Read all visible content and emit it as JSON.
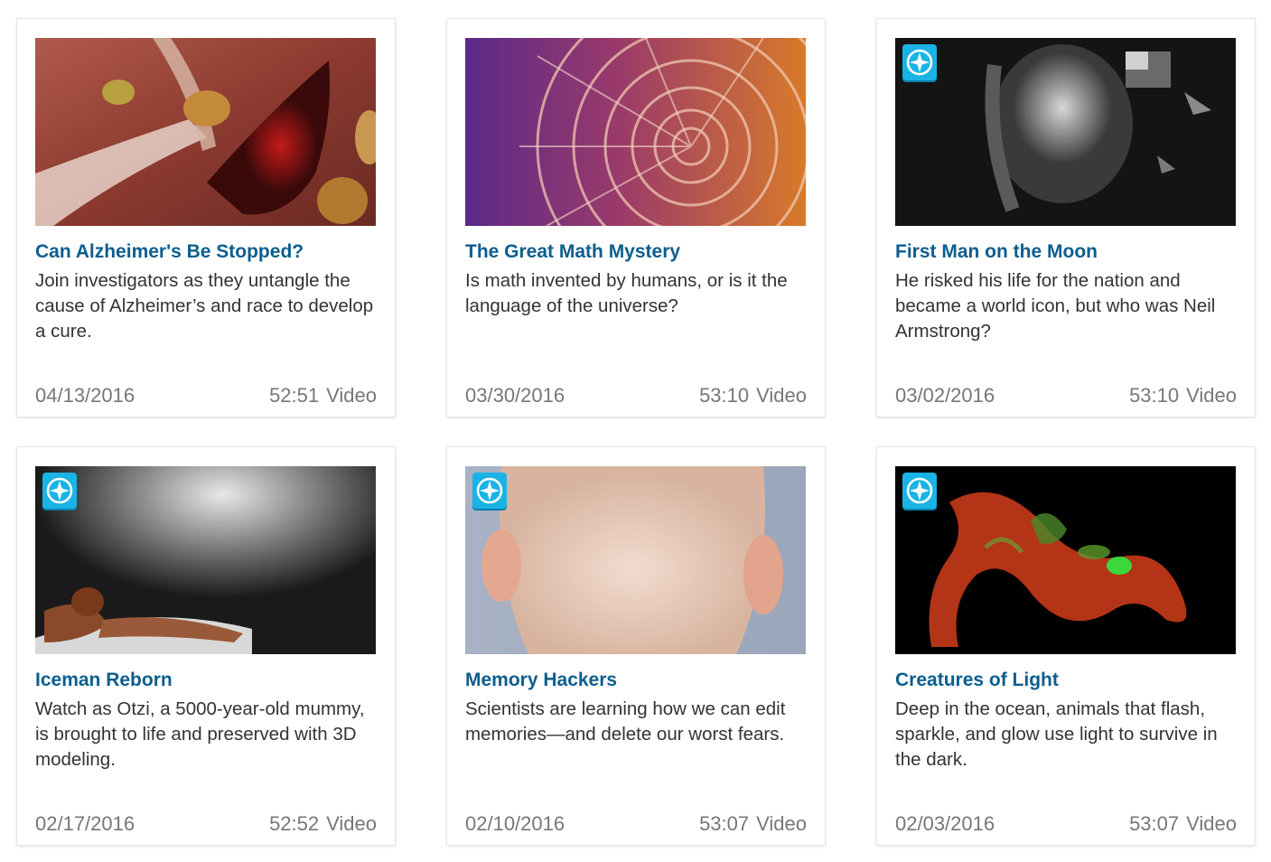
{
  "cards": [
    {
      "title": "Can Alzheimer's Be Stopped?",
      "description": "Join investigators as they untangle the cause of Alzheimer’s and race to develop a cure.",
      "date": "04/13/2016",
      "duration": "52:51",
      "type": "Video",
      "badge": false
    },
    {
      "title": "The Great Math Mystery",
      "description": "Is math invented by humans, or is it the language of the universe?",
      "date": "03/30/2016",
      "duration": "53:10",
      "type": "Video",
      "badge": false
    },
    {
      "title": "First Man on the Moon",
      "description": "He risked his life for the nation and became a world icon, but who was Neil Armstrong?",
      "date": "03/02/2016",
      "duration": "53:10",
      "type": "Video",
      "badge": true,
      "badge_icon": "compass-icon"
    },
    {
      "title": "Iceman Reborn",
      "description": "Watch as Otzi, a 5000-year-old mummy, is brought to life and preserved with 3D modeling.",
      "date": "02/17/2016",
      "duration": "52:52",
      "type": "Video",
      "badge": true,
      "badge_icon": "compass-icon"
    },
    {
      "title": "Memory Hackers",
      "description": "Scientists are learning how we can edit memories—and delete our worst fears.",
      "date": "02/10/2016",
      "duration": "53:07",
      "type": "Video",
      "badge": true,
      "badge_icon": "compass-icon"
    },
    {
      "title": "Creatures of Light",
      "description": "Deep in the ocean, animals that flash, sparkle, and glow use light to survive in the dark.",
      "date": "02/03/2016",
      "duration": "53:07",
      "type": "Video",
      "badge": true,
      "badge_icon": "compass-icon"
    }
  ],
  "colors": {
    "title": "#0b5e8e",
    "text": "#333333",
    "meta": "#777777",
    "badge": "#1ab3e6"
  }
}
